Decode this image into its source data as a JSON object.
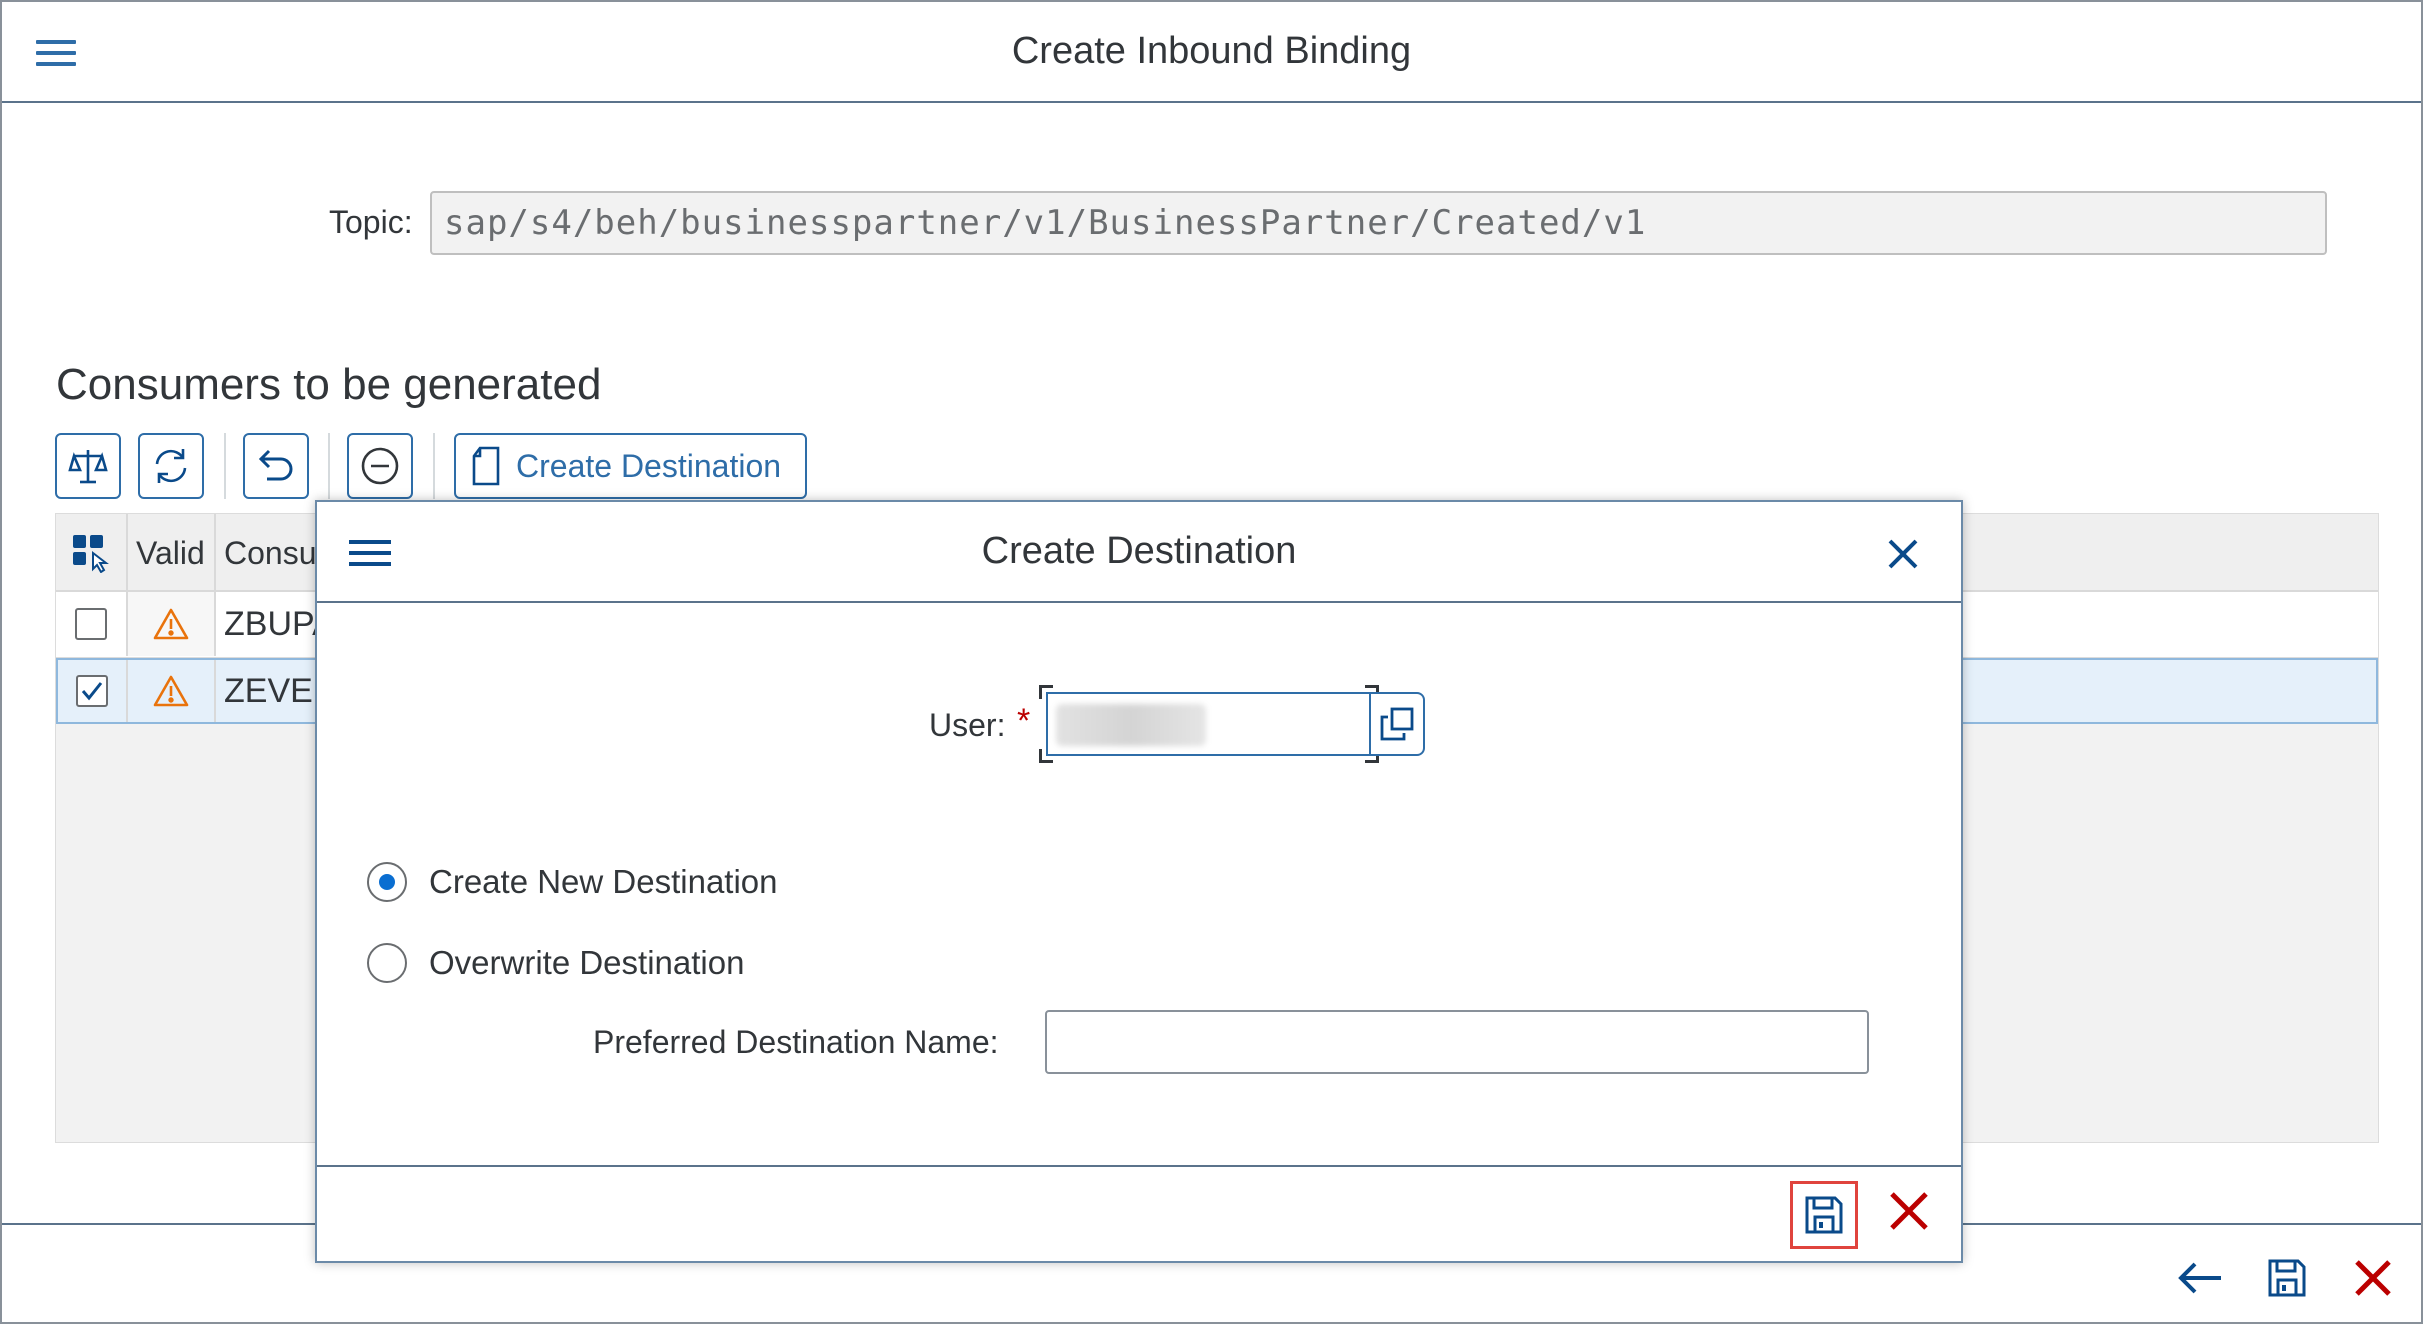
{
  "header": {
    "title": "Create Inbound Binding",
    "menu_icon": "hamburger-menu-icon"
  },
  "topic": {
    "label": "Topic:",
    "value": "sap/s4/beh/businesspartner/v1/BusinessPartner/Created/v1"
  },
  "section": {
    "title": "Consumers to be generated"
  },
  "toolbar": {
    "buttons": [
      "balance-scale-icon",
      "refresh-icon",
      "undo-icon",
      "remove-icon"
    ],
    "create_destination_label": "Create Destination"
  },
  "table": {
    "columns": [
      "Valid",
      "Consu"
    ],
    "rows": [
      {
        "selected": false,
        "status": "warning",
        "consumer": "ZBUPA"
      },
      {
        "selected": true,
        "status": "warning",
        "consumer": "ZEVEI"
      }
    ]
  },
  "dialog": {
    "title": "Create Destination",
    "user_label": "User:",
    "required_mark": "*",
    "options": [
      {
        "label": "Create New Destination",
        "selected": true
      },
      {
        "label": "Overwrite Destination",
        "selected": false
      }
    ],
    "preferred_label": "Preferred Destination Name:",
    "preferred_value": ""
  },
  "colors": {
    "accent": "#2e6da8",
    "cancel": "#bb0000",
    "highlight": "#e0443d"
  }
}
